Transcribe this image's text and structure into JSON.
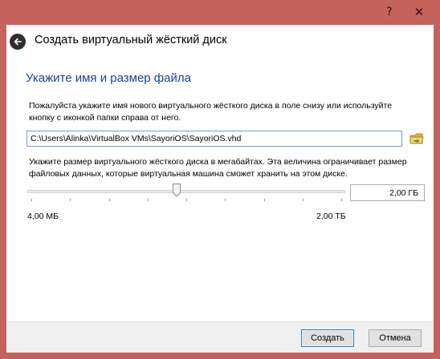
{
  "titlebar": {
    "help_label": "?",
    "close_label": "✕"
  },
  "header": {
    "back_icon": "back-arrow-icon",
    "title": "Создать виртуальный жёсткий диск"
  },
  "page": {
    "heading": "Укажите имя и размер файла",
    "location_description": "Пожалуйста укажите имя нового виртуального жёсткого диска в поле снизу или используйте кнопку с иконкой папки справа от него.",
    "file_path": "C:\\Users\\Alinka\\VirtualBox VMs\\SayoriOS\\SayoriOS.vhd",
    "folder_icon": "folder-browse-icon",
    "size_description": "Укажите размер виртуального жёсткого диска в мегабайтах. Эта величина ограничивает размер файловых данных, которые виртуальная машина сможет хранить на этом диске.",
    "size_value": "2,00 ГБ",
    "slider_fraction": 0.47,
    "slider_tick_count": 8,
    "min_label": "4,00 МБ",
    "max_label": "2,00 ТБ"
  },
  "footer": {
    "create_label": "Создать",
    "cancel_label": "Отмена"
  },
  "colors": {
    "window_frame": "#c4625b",
    "heading": "#1c3f97",
    "input_border_focus": "#7a9bd1"
  }
}
